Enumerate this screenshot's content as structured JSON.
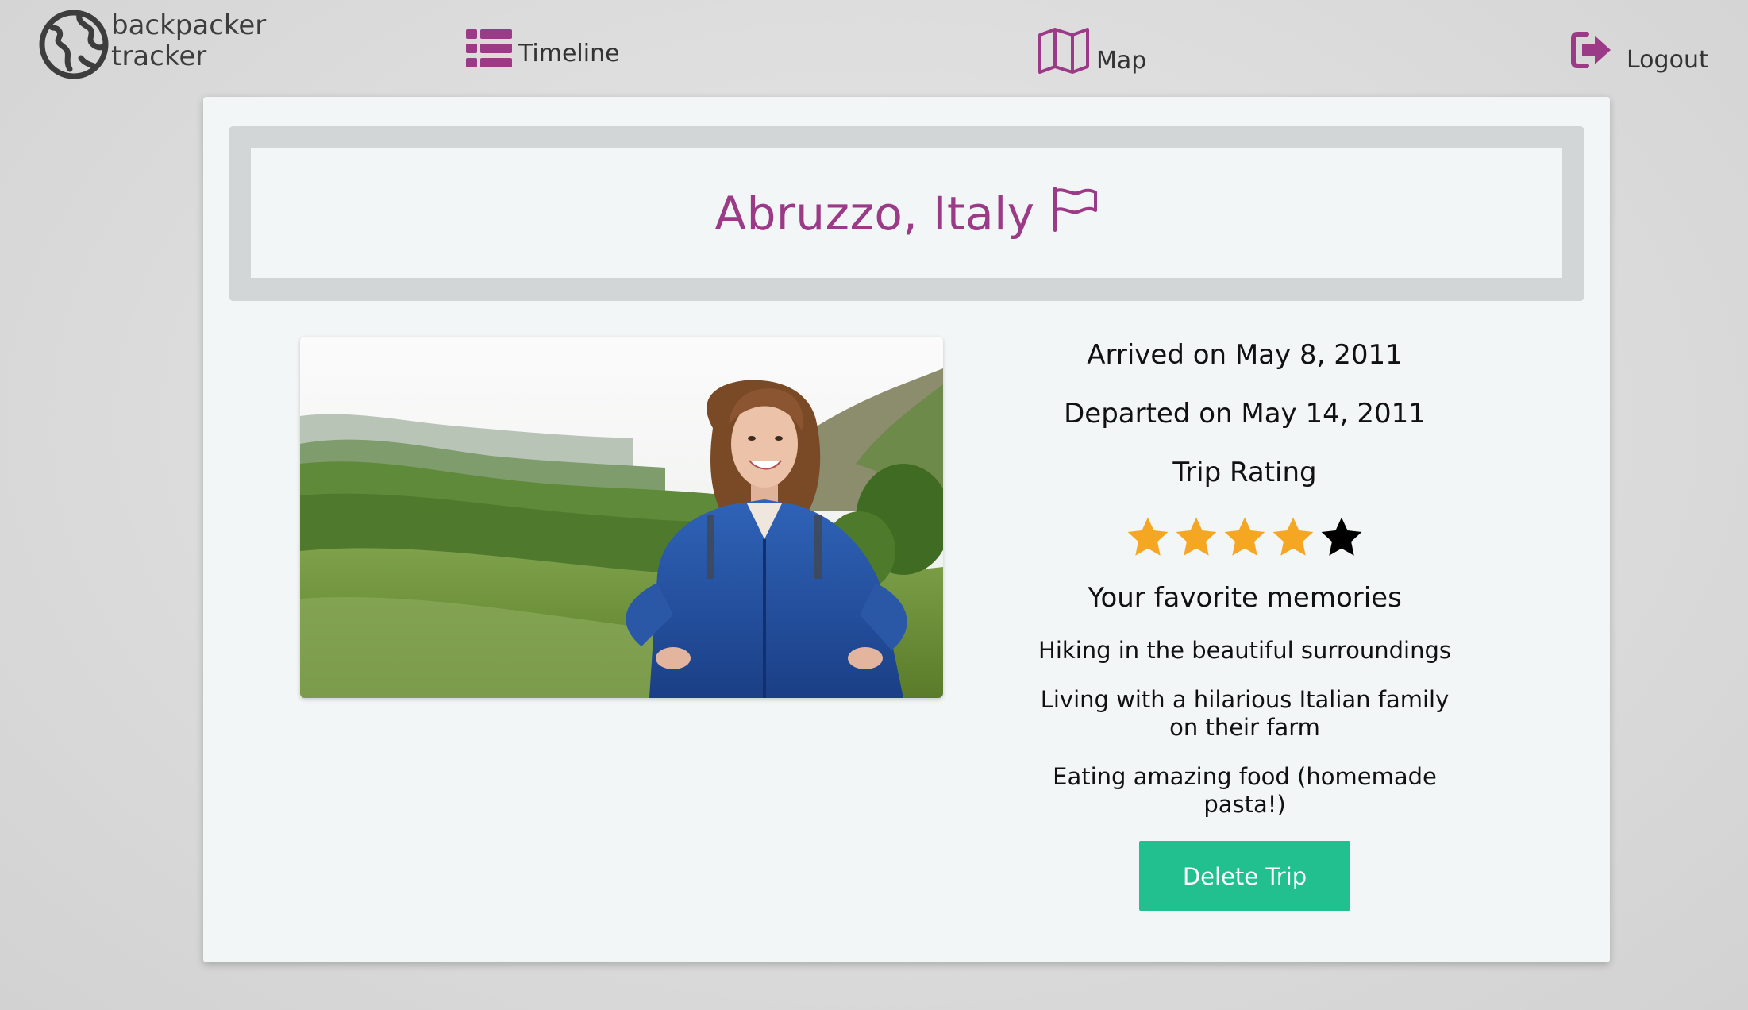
{
  "brand": {
    "line1": "backpacker",
    "line2": "tracker",
    "icon": "globe-icon"
  },
  "nav": {
    "timeline": {
      "label": "Timeline",
      "icon": "list-icon"
    },
    "map": {
      "label": "Map",
      "icon": "map-icon"
    },
    "logout": {
      "label": "Logout",
      "icon": "sign-out-icon"
    }
  },
  "trip": {
    "title": "Abruzzo, Italy",
    "title_icon": "flag-icon",
    "arrived": "Arrived on May 8, 2011",
    "departed": "Departed on May 14, 2011",
    "rating_label": "Trip Rating",
    "rating": 4,
    "rating_max": 5,
    "memories_title": "Your favorite memories",
    "memories": [
      "Hiking in the beautiful surroundings",
      "Living with a hilarious Italian family on their farm",
      "Eating amazing food (homemade pasta!)"
    ],
    "delete_label": "Delete Trip"
  },
  "colors": {
    "accent": "#9b3a87",
    "star_filled": "#f5a623",
    "star_empty": "#000000",
    "delete_button": "#22c08e",
    "card_bg": "#f3f6f7",
    "title_frame": "#d3d6d6"
  }
}
